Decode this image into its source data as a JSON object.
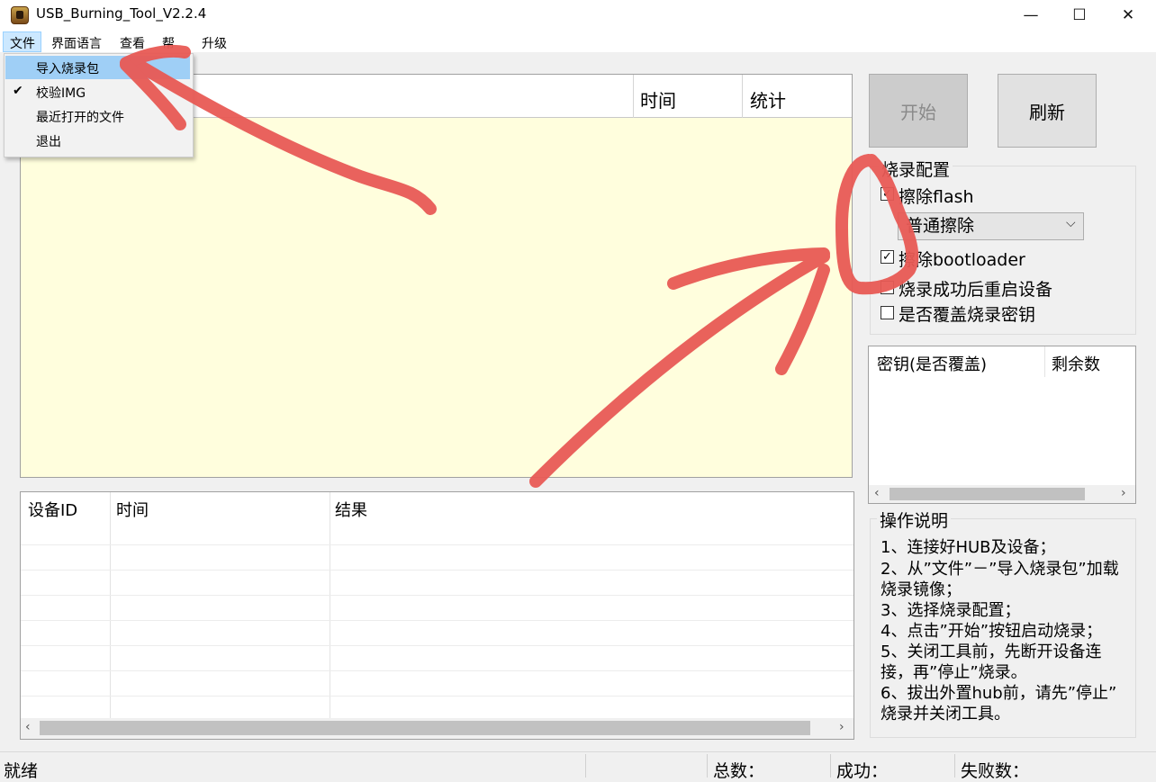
{
  "window": {
    "title": "USB_Burning_Tool_V2.2.4",
    "minimize": "—",
    "maximize": "☐",
    "close": "✕"
  },
  "menu": {
    "file": "文件",
    "language": "界面语言",
    "view": "查看",
    "help_partial": "帮",
    "upgrade": "升级"
  },
  "dropdown": {
    "items": [
      "导入烧录包",
      "校验IMG",
      "最近打开的文件",
      "退出"
    ],
    "check": "✔"
  },
  "main_list": {
    "headers": {
      "time": "时间",
      "stats": "统计"
    }
  },
  "grid": {
    "headers": [
      "设备ID",
      "时间",
      "结果"
    ]
  },
  "buttons": {
    "start": "开始",
    "refresh": "刷新"
  },
  "config": {
    "title": "烧录配置",
    "erase_flash": "擦除flash",
    "erase_mode": "普通擦除",
    "erase_bootloader": "擦除bootloader",
    "reboot_after": "烧录成功后重启设备",
    "overwrite_key": "是否覆盖烧录密钥",
    "erase_flash_checked": true,
    "erase_bootloader_checked": true,
    "reboot_after_checked": false,
    "overwrite_key_checked": false
  },
  "key_list": {
    "headers": [
      "密钥(是否覆盖)",
      "剩余数"
    ]
  },
  "help": {
    "title": "操作说明",
    "lines": [
      "1、连接好HUB及设备；",
      "2、从”文件”－”导入烧录包”加载",
      "烧录镜像；",
      "3、选择烧录配置；",
      "4、点击”开始”按钮启动烧录；",
      "5、关闭工具前，先断开设备连",
      "接，再”停止”烧录。",
      "6、拔出外置hub前，请先”停止”",
      "烧录并关闭工具。"
    ]
  },
  "status": {
    "ready": "就绪",
    "total": "总数：",
    "success": "成功：",
    "failed": "失败数："
  },
  "colors": {
    "annotation": "#e85a55",
    "list_bg": "#fffedd"
  }
}
